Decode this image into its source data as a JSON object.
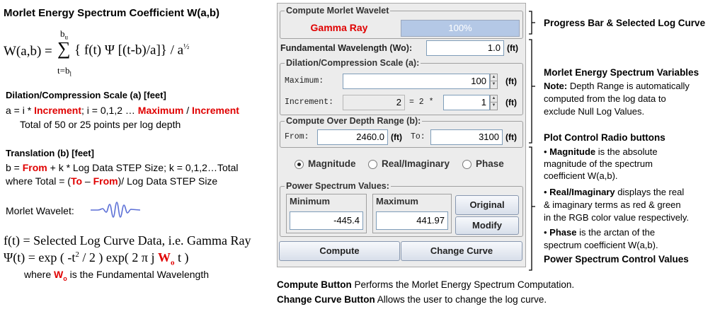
{
  "doc": {
    "title": "Morlet Energy Spectrum Coefficient W(a,b)",
    "formula": {
      "lhs": "W(a,b) = ",
      "sum": "∑",
      "upper": "b",
      "upper_sub": "u",
      "lower": "t=b",
      "lower_sub": "l",
      "body": "{ f(t) Ψ [(t-b)/a]} / a",
      "exp": "½"
    },
    "dilation": {
      "heading": "Dilation/Compression Scale (a) [feet]",
      "l1_a": "a  =  i * ",
      "l1_inc": "Increment",
      "l1_b": ";  i = 0,1,2 … ",
      "l1_max": "Maximum",
      "l1_c": " / ",
      "l1_inc2": "Increment",
      "l2": "Total of 50  or 25 points per log depth"
    },
    "translation": {
      "heading": "Translation (b) [feet]",
      "l1_a": "b  = ",
      "l1_from": "From",
      "l1_b": " + k * Log Data STEP Size; k = 0,1,2…Total",
      "l2_a": "where Total = (",
      "l2_to": "To",
      "l2_b": " – ",
      "l2_from": "From",
      "l2_c": ")/ Log Data STEP Size"
    },
    "wavelet_label": "Morlet Wavelet:",
    "f_line": "f(t) = Selected Log Curve Data, i.e. Gamma Ray",
    "psi_a": "Ψ(t) = exp ( -t",
    "psi_sup": "2",
    "psi_b": " / 2 ) exp( 2 π j ",
    "psi_w": "W",
    "psi_wsub": "o",
    "psi_c": " t )",
    "where_a": "where ",
    "where_w": "W",
    "where_wsub": "o",
    "where_b": " is the Fundamental Wavelength"
  },
  "dialog": {
    "compute_group": "Compute Morlet Wavelet",
    "curve_name": "Gamma Ray",
    "progress_text": "100%",
    "progress": 1.0,
    "fund_label": "Fundamental Wavelength (Wo):",
    "fund_value": "1.0",
    "unit_ft": "(ft)",
    "dil_group": "Dilation/Compression Scale (a):",
    "max_label": "Maximum:",
    "max_value": "100",
    "inc_label": "Increment:",
    "inc_disabled_value": "2",
    "inc_eq": "= 2 *",
    "inc_value": "1",
    "depth_group": "Compute Over Depth Range (b):",
    "from_label": "From:",
    "from_value": "2460.0",
    "to_label": "To:",
    "to_value": "3100",
    "radio_magnitude": "Magnitude",
    "radio_realimag": "Real/Imaginary",
    "radio_phase": "Phase",
    "power_group": "Power Spectrum Values:",
    "min_label": "Minimum",
    "min_value": "-445.4",
    "max2_label": "Maximum",
    "max2_value": "441.97",
    "original_btn": "Original",
    "modify_btn": "Modify",
    "compute_btn": "Compute",
    "change_curve_btn": "Change Curve"
  },
  "notes": {
    "progress_heading": "Progress Bar & Selected Log Curve",
    "vars_heading": "Morlet Energy Spectrum Variables",
    "note_bold": "Note:",
    "note_l1": " Depth Range is automatically",
    "note_l2": "computed from the log data to",
    "note_l3": "exclude Null Log Values.",
    "radio_heading": "Plot Control Radio buttons",
    "mag_bold": "Magnitude",
    "mag_l1": " is the absolute",
    "mag_l2": "magnitude of the spectrum",
    "mag_l3": "coefficient W(a,b).",
    "ri_bold": "Real/Imaginary",
    "ri_l1": " displays the real",
    "ri_l2": "& imaginary terms as red & green",
    "ri_l3": "in the RGB color value respectively.",
    "ph_bold": "Phase",
    "ph_l1": " is the arctan of the",
    "ph_l2": "spectrum coefficient W(a,b).",
    "power_heading": "Power Spectrum Control Values",
    "compute_bold": "Compute Button",
    "compute_text": " Performs the Morlet Energy Spectrum Computation.",
    "change_bold": "Change Curve Button",
    "change_text": "  Allows the user to change the log curve."
  },
  "colors": {
    "red_text": "#e00000",
    "progress_fill": "#b4c8e6",
    "wavelet": "#5b6fd6"
  }
}
